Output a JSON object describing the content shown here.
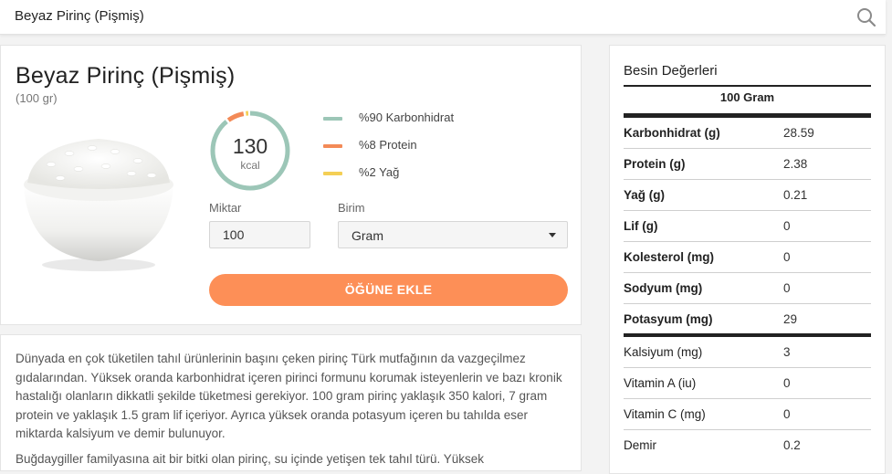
{
  "search": {
    "query": "Beyaz Pirinç (Pişmiş)"
  },
  "food": {
    "title": "Beyaz Pirinç (Pişmiş)",
    "portion": "(100 gr)",
    "calories": "130",
    "calorie_unit": "kcal",
    "macros": [
      {
        "label": "%90 Karbonhidrat",
        "percent": 90,
        "color": "#9cc6b7"
      },
      {
        "label": "%8 Protein",
        "percent": 8,
        "color": "#f38a57"
      },
      {
        "label": "%2 Yağ",
        "percent": 2,
        "color": "#f4cf55"
      }
    ],
    "amount_label": "Miktar",
    "amount_value": "100",
    "unit_label": "Birim",
    "unit_value": "Gram",
    "add_button": "ÖĞÜNE EKLE"
  },
  "description": [
    "Dünyada en çok tüketilen tahıl ürünlerinin başını çeken pirinç Türk mutfağının da vazgeçilmez gıdalarından. Yüksek oranda karbonhidrat içeren pirinci formunu korumak isteyenlerin ve bazı kronik hastalığı olanların dikkatli şekilde tüketmesi gerekiyor. 100 gram pirinç yaklaşık 350 kalori, 7 gram protein ve yaklaşık 1.5 gram lif içeriyor. Ayrıca yüksek oranda potasyum içeren bu tahılda eser miktarda kalsiyum ve demir bulunuyor.",
    "Buğdaygiller familyasına ait bir bitki olan pirinç, su içinde yetişen tek tahıl türü. Yüksek"
  ],
  "nutrition": {
    "title": "Besin Değerleri",
    "header": "100 Gram",
    "rows": [
      {
        "name": "Karbonhidrat (g)",
        "value": "28.59"
      },
      {
        "name": "Protein (g)",
        "value": "2.38"
      },
      {
        "name": "Yağ (g)",
        "value": "0.21"
      },
      {
        "name": "Lif (g)",
        "value": "0"
      },
      {
        "name": "Kolesterol (mg)",
        "value": "0"
      },
      {
        "name": "Sodyum (mg)",
        "value": "0"
      },
      {
        "name": "Potasyum (mg)",
        "value": "29"
      },
      {
        "name": "Kalsiyum (mg)",
        "value": "3"
      },
      {
        "name": "Vitamin A (iu)",
        "value": "0"
      },
      {
        "name": "Vitamin C (mg)",
        "value": "0"
      },
      {
        "name": "Demir",
        "value": "0.2"
      }
    ]
  }
}
